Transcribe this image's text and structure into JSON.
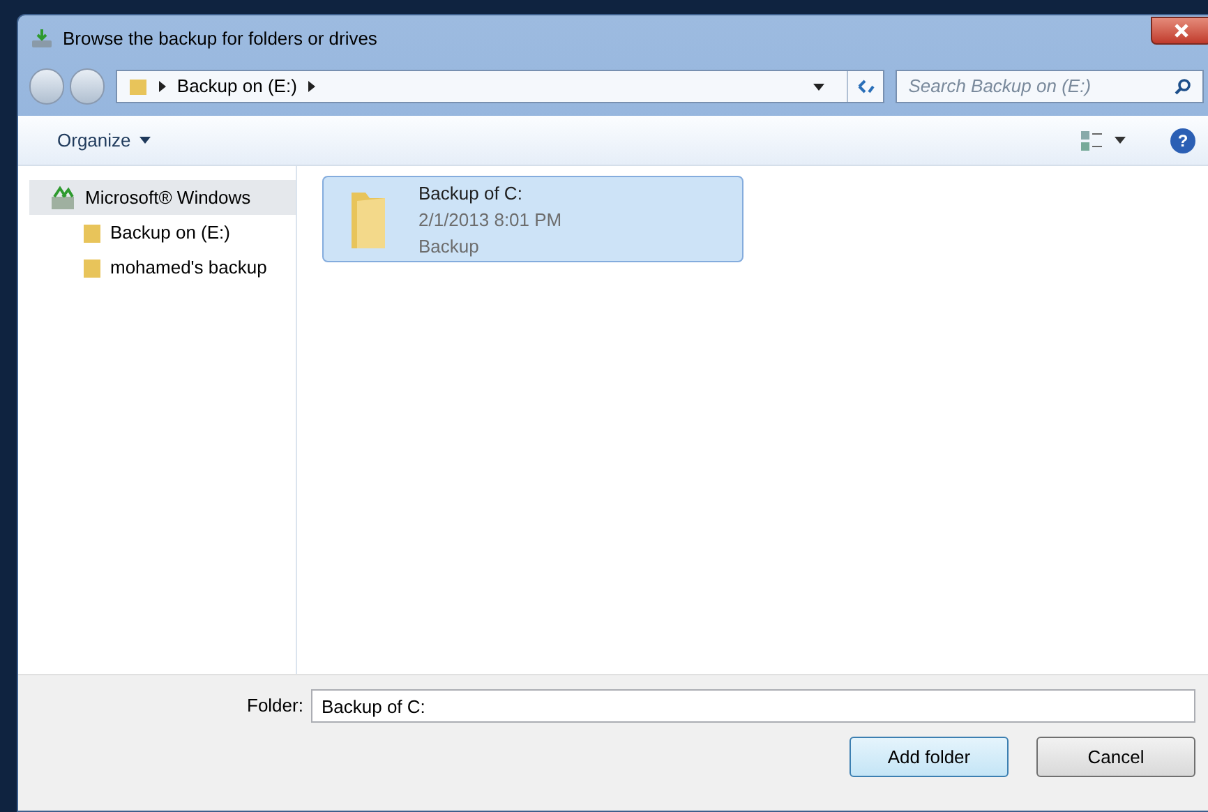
{
  "window": {
    "title": "Browse the backup for folders or drives"
  },
  "address_bar": {
    "path": [
      "Backup on (E:)"
    ]
  },
  "search": {
    "placeholder": "Search Backup on (E:)"
  },
  "toolbar": {
    "organize": "Organize",
    "help": "?"
  },
  "sidebar": {
    "items": [
      {
        "label": "Microsoft® Windows",
        "selected": true,
        "children": [
          {
            "label": "Backup on (E:)",
            "selected": false
          },
          {
            "label": "mohamed's backup",
            "selected": false
          }
        ]
      }
    ]
  },
  "files": [
    {
      "name": "Backup of C:",
      "date": "2/1/2013 8:01 PM",
      "type": "Backup",
      "selected": true
    }
  ],
  "folder_field": {
    "label": "Folder:",
    "value": "Backup of C:"
  },
  "buttons": [
    {
      "label": "Add folder",
      "kind": "default"
    },
    {
      "label": "Cancel",
      "kind": "normal"
    }
  ]
}
